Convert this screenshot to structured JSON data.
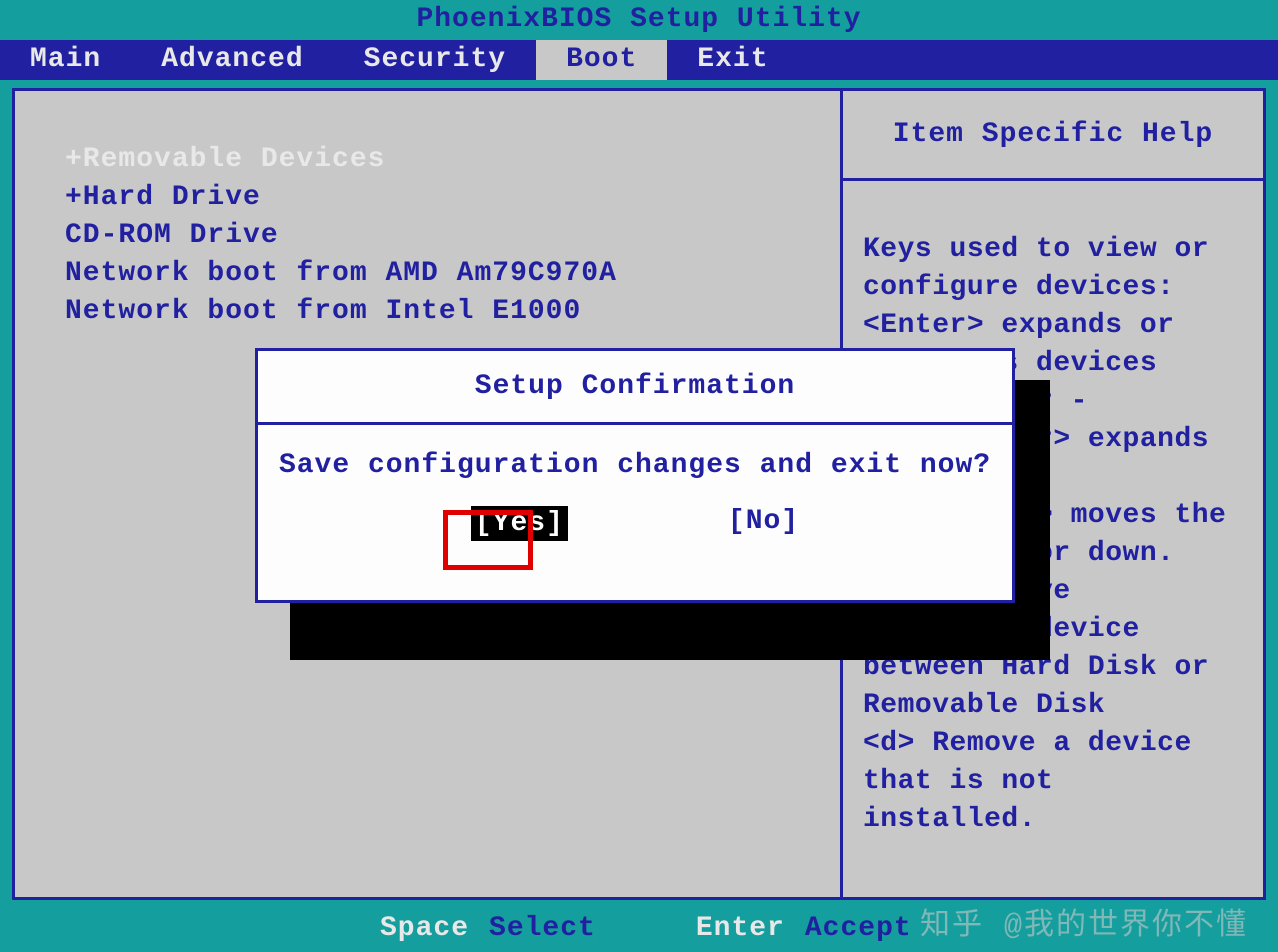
{
  "title": "PhoenixBIOS Setup Utility",
  "menu": {
    "items": [
      "Main",
      "Advanced",
      "Security",
      "Boot",
      "Exit"
    ],
    "active": "Boot"
  },
  "boot": {
    "items": [
      "+Removable Devices",
      "+Hard Drive",
      " CD-ROM Drive",
      " Network boot from AMD Am79C970A",
      " Network boot from Intel E1000"
    ],
    "selected_index": 0
  },
  "help": {
    "title": "Item Specific Help",
    "body": "Keys used to view or configure devices:\n<Enter> expands or collapses devices with a + or -\n<Ctrl+Enter> expands all\n<+> and <-> moves the device up or down.\n<n> May move removable device between Hard Disk or Removable Disk\n<d> Remove a device that is not installed."
  },
  "dialog": {
    "title": "Setup Confirmation",
    "message": "Save configuration changes and exit now?",
    "yes": "[Yes]",
    "no": "[No]"
  },
  "footer": {
    "key1": "Space",
    "label1": "Select",
    "key2": "Enter",
    "label2": "Accept"
  },
  "watermark": "知乎 @我的世界你不懂"
}
